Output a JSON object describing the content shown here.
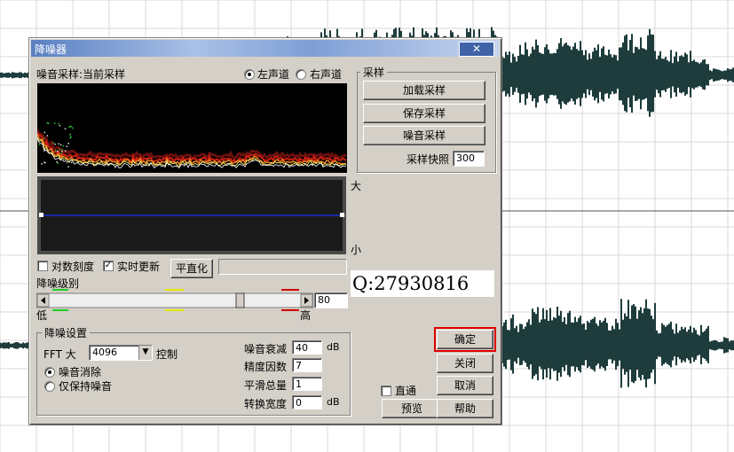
{
  "dialog": {
    "title": "降噪器",
    "close_label": "✕"
  },
  "sample_header": {
    "label": "噪音采样:当前采样",
    "left_channel": "左声道",
    "right_channel": "右声道",
    "selected_channel": "left"
  },
  "sampling": {
    "group_label": "采样",
    "load_button": "加载采样",
    "save_button": "保存采样",
    "noise_button": "噪音采样",
    "snapshot_label": "采样快照",
    "snapshot_value": "300"
  },
  "graph_labels": {
    "big": "大",
    "small": "小"
  },
  "options": {
    "log_scale_label": "对数刻度",
    "log_scale_checked": false,
    "realtime_label": "实时更新",
    "realtime_checked": true,
    "flatten_button": "平直化"
  },
  "reduction_level": {
    "label": "降噪级别",
    "low": "低",
    "high": "高",
    "value": "80"
  },
  "watermark": "Q:27930816",
  "settings": {
    "group_label": "降噪设置",
    "fft_label": "FFT 大",
    "fft_value": "4096",
    "control_label": "控制",
    "mode_remove": "噪音消除",
    "mode_keep": "仅保持噪音",
    "selected_mode": "remove",
    "attenuation_label": "噪音衰减",
    "attenuation_value": "40",
    "attenuation_unit": "dB",
    "precision_label": "精度因数",
    "precision_value": "7",
    "smoothing_label": "平滑总量",
    "smoothing_value": "1",
    "transition_label": "转换宽度",
    "transition_value": "0",
    "transition_unit": "dB"
  },
  "footer": {
    "passthrough_label": "直通",
    "passthrough_checked": false,
    "preview_button": "预览",
    "ok_button": "确定",
    "close_button": "关闭",
    "cancel_button": "取消",
    "help_button": "帮助"
  },
  "colors": {
    "waveform": "#1e3c3c",
    "ok_highlight": "#e00000",
    "title_bar": "#5a7fc3",
    "curve": "#1a30d0"
  }
}
